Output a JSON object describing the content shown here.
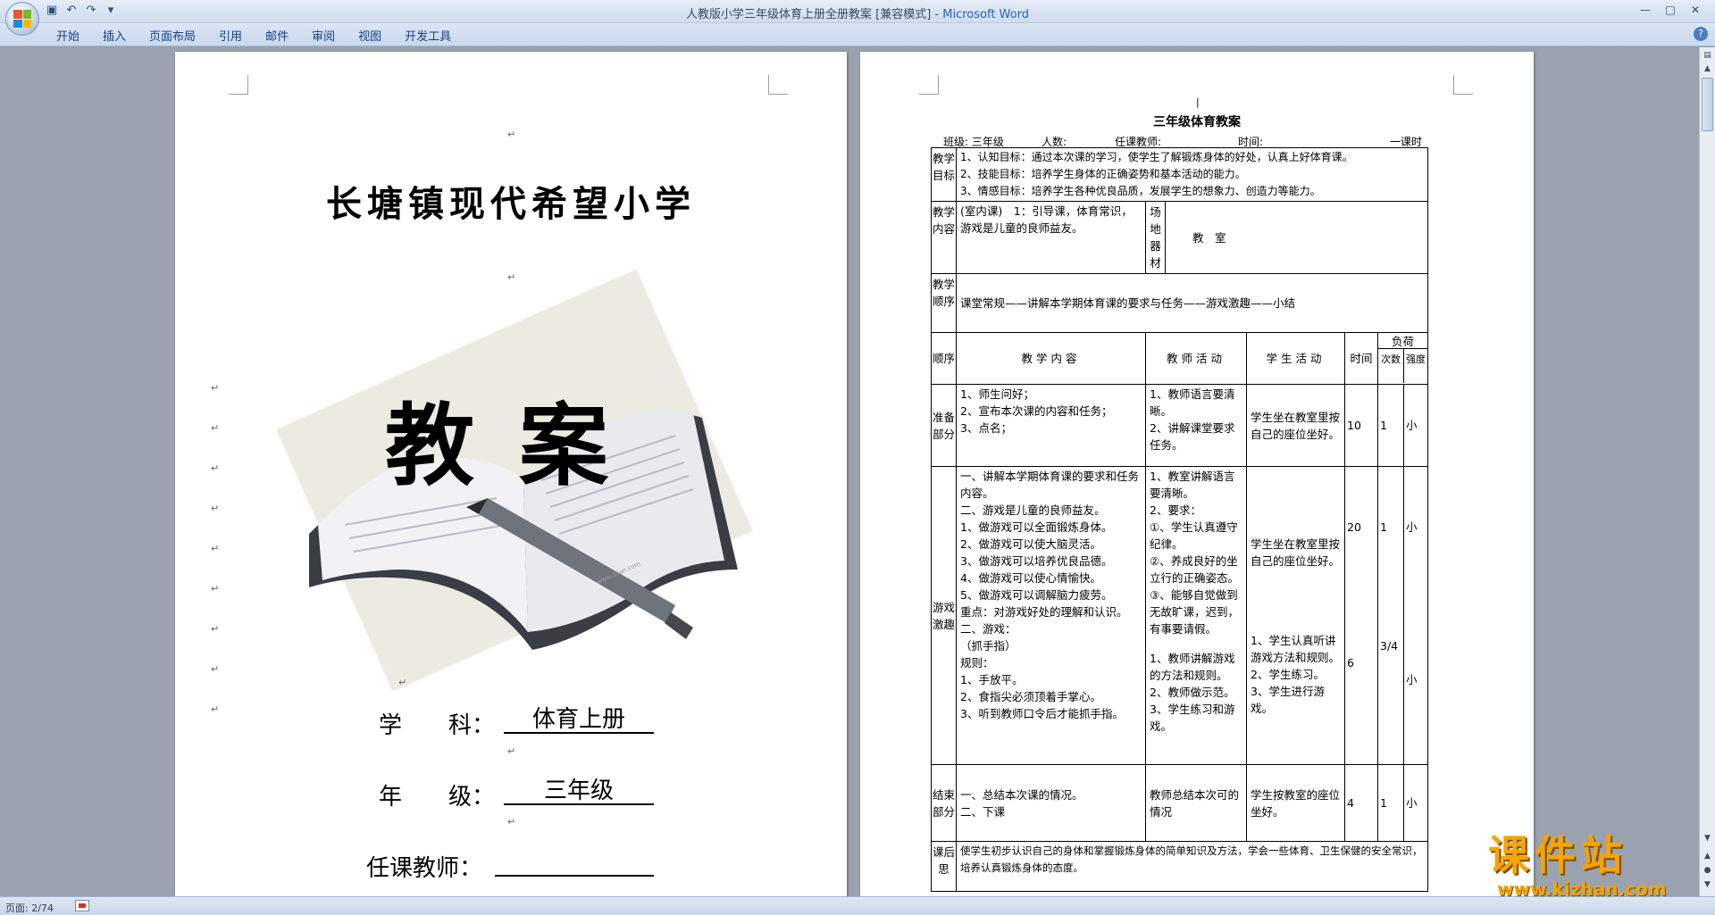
{
  "window": {
    "title": "人教版小学三年级体育上册全册教案 [兼容模式] - ",
    "app_name": "Microsoft Word"
  },
  "ribbon": {
    "tabs": [
      "开始",
      "插入",
      "页面布局",
      "引用",
      "邮件",
      "审阅",
      "视图",
      "开发工具"
    ]
  },
  "status": {
    "page": "页面: 2/74"
  },
  "cover": {
    "school": "长塘镇现代希望小学",
    "title": "教案",
    "watermark": "www.3lian.com",
    "subject_label": "学　　科：",
    "subject_value": "体育上册",
    "grade_label": "年　　级：",
    "grade_value": "三年级",
    "teacher_label": "任课教师：",
    "teacher_value": ""
  },
  "plan": {
    "title": "三年级体育教案",
    "meta": {
      "class": "班级: 三年级",
      "count": "人数:",
      "teacher": "任课教师:",
      "time": "时间:",
      "lesson": "一课时"
    },
    "goals_label": "教学目标",
    "goals": [
      "1、认知目标：通过本次课的学习，使学生了解锻炼身体的好处，认真上好体育课。",
      "2、技能目标：培养学生身体的正确姿势和基本活动的能力。",
      "3、情感目标：培养学生各种优良品质，发展学生的想象力、创造力等能力。"
    ],
    "content_label": "教学内容",
    "content": "(室内课)　1：引导课，体育常识，游戏是儿童的良师益友。",
    "equip_label": "场地器材",
    "equip": "教　室",
    "order_label": "教学顺序",
    "order": "课堂常规——讲解本学期体育课的要求与任务——游戏激趣——小结",
    "headers": {
      "seq": "顺序",
      "content": "教学内容",
      "teacher": "教师活动",
      "student": "学生活动",
      "time": "时间",
      "load": "负荷",
      "times": "次数",
      "intensity": "强度"
    },
    "rows": [
      {
        "label": "准备部分",
        "content": [
          "1、师生问好；",
          "2、宣布本次课的内容和任务；",
          "3、点名；"
        ],
        "teacher": [
          "1、教师语言要清晰。",
          "2、讲解课堂要求任务。"
        ],
        "student": [
          "学生坐在教室里按自己的座位坐好。"
        ],
        "time": "10",
        "times": "1",
        "intensity": "小"
      },
      {
        "label": "游戏激趣",
        "content": [
          "一、讲解本学期体育课的要求和任务内容。",
          "二、游戏是儿童的良师益友。",
          "1、做游戏可以全面锻炼身体。",
          "2、做游戏可以使大脑灵活。",
          "3、做游戏可以培养优良品德。",
          "4、做游戏可以使心情愉快。",
          "5、做游戏可以调解脑力疲劳。",
          "重点：对游戏好处的理解和认识。",
          "二、游戏：",
          "（抓手指）",
          "规则：",
          "1、手放平。",
          "2、食指尖必须顶着手掌心。",
          "3、听到教师口令后才能抓手指。"
        ],
        "teacher": [
          "1、教室讲解语言要清晰。",
          "2、要求：",
          "①、学生认真遵守纪律。",
          "②、养成良好的坐立行的正确姿态。",
          "③、能够自觉做到无故旷课，迟到，有事要请假。",
          "1、教师讲解游戏的方法和规则。",
          "2、教师做示范。",
          "3、学生练习和游戏。"
        ],
        "student": [
          "学生坐在教室里按自己的座位坐好。",
          "1、学生认真听讲游戏方法和规则。",
          "2、学生练习。",
          "3、学生进行游戏。"
        ],
        "time1": "20",
        "time2": "6",
        "times1": "1",
        "times2": "3/4",
        "intensity1": "小",
        "intensity2": "小"
      },
      {
        "label": "结束部分",
        "content": [
          "一、总结本次课的情况。",
          "二、下课"
        ],
        "teacher": [
          "教师总结本次可的情况"
        ],
        "student": [
          "学生按教室的座位坐好。"
        ],
        "time": "4",
        "times": "1",
        "intensity": "小"
      }
    ],
    "reflection_label": "课后思",
    "reflection": "使学生初步认识自己的身体和掌握锻炼身体的简单知识及方法，学会一些体育、卫生保健的安全常识，培养认真锻炼身体的态度。"
  },
  "logo": {
    "cn": "课件站",
    "en": "www.kjzhan.com"
  }
}
